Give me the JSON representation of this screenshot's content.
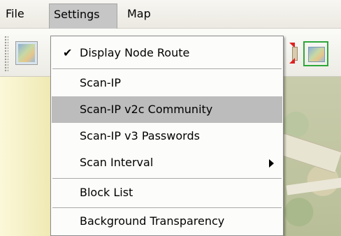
{
  "menubar": {
    "items": [
      {
        "label": "File"
      },
      {
        "label": "Settings"
      },
      {
        "label": "Map"
      }
    ]
  },
  "settings_menu": {
    "items": [
      {
        "label": "Display Node Route",
        "checked": true
      },
      {
        "label": "Scan-IP"
      },
      {
        "label": "Scan-IP v2c Community",
        "highlighted": true
      },
      {
        "label": "Scan-IP v3 Passwords"
      },
      {
        "label": "Scan Interval",
        "has_submenu": true
      },
      {
        "label": "Block List"
      },
      {
        "label": "Background Transparency"
      }
    ],
    "check_glyph": "✔"
  },
  "toolbar": {
    "buttons": [
      {
        "icon": "map-icon"
      },
      {
        "icon": "collapse-red-arrows-icon"
      },
      {
        "icon": "fit-map-green-icon"
      }
    ]
  },
  "colors": {
    "menu_highlight": "#bcbcbc",
    "settings_active": "#c6c6c6",
    "left_panel": "#f5f0c4",
    "fit_button_border": "#2ea83a",
    "red_arrow": "#e02020"
  }
}
